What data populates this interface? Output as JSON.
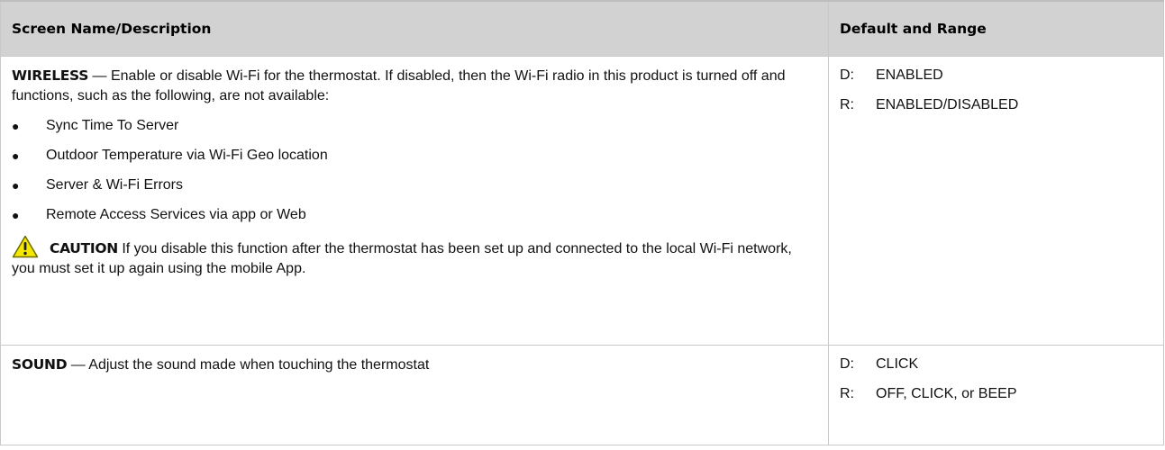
{
  "table": {
    "headers": {
      "description": "Screen Name/Description",
      "default_range": "Default and Range"
    },
    "rows": [
      {
        "keyword": "WIRELESS",
        "description": " — Enable or disable Wi-Fi for the thermostat. If disabled, then the Wi-Fi radio in this product is turned off and functions, such as the following, are not available:",
        "bullets": [
          "Sync Time To Server",
          "Outdoor Temperature via Wi-Fi Geo location",
          "Server & Wi-Fi Errors",
          "Remote Access Services via app or Web"
        ],
        "caution": {
          "icon": "warning-icon",
          "label": "CAUTION",
          "text": " If you disable this function after the thermostat has been set up and connected to the local Wi-Fi network, you must set it up again using the mobile App."
        },
        "default_key": "D:",
        "default_value": "ENABLED",
        "range_key": "R:",
        "range_value": "ENABLED/DISABLED"
      },
      {
        "keyword": "SOUND",
        "description": " — Adjust the sound made when touching the thermostat",
        "default_key": "D:",
        "default_value": "CLICK",
        "range_key": "R:",
        "range_value": "OFF, CLICK, or BEEP"
      }
    ]
  },
  "colors": {
    "header_background": "#d2d2d2",
    "border": "#c9c9c9",
    "warning_fill": "#f5e800",
    "warning_outline": "#6b6b00"
  }
}
